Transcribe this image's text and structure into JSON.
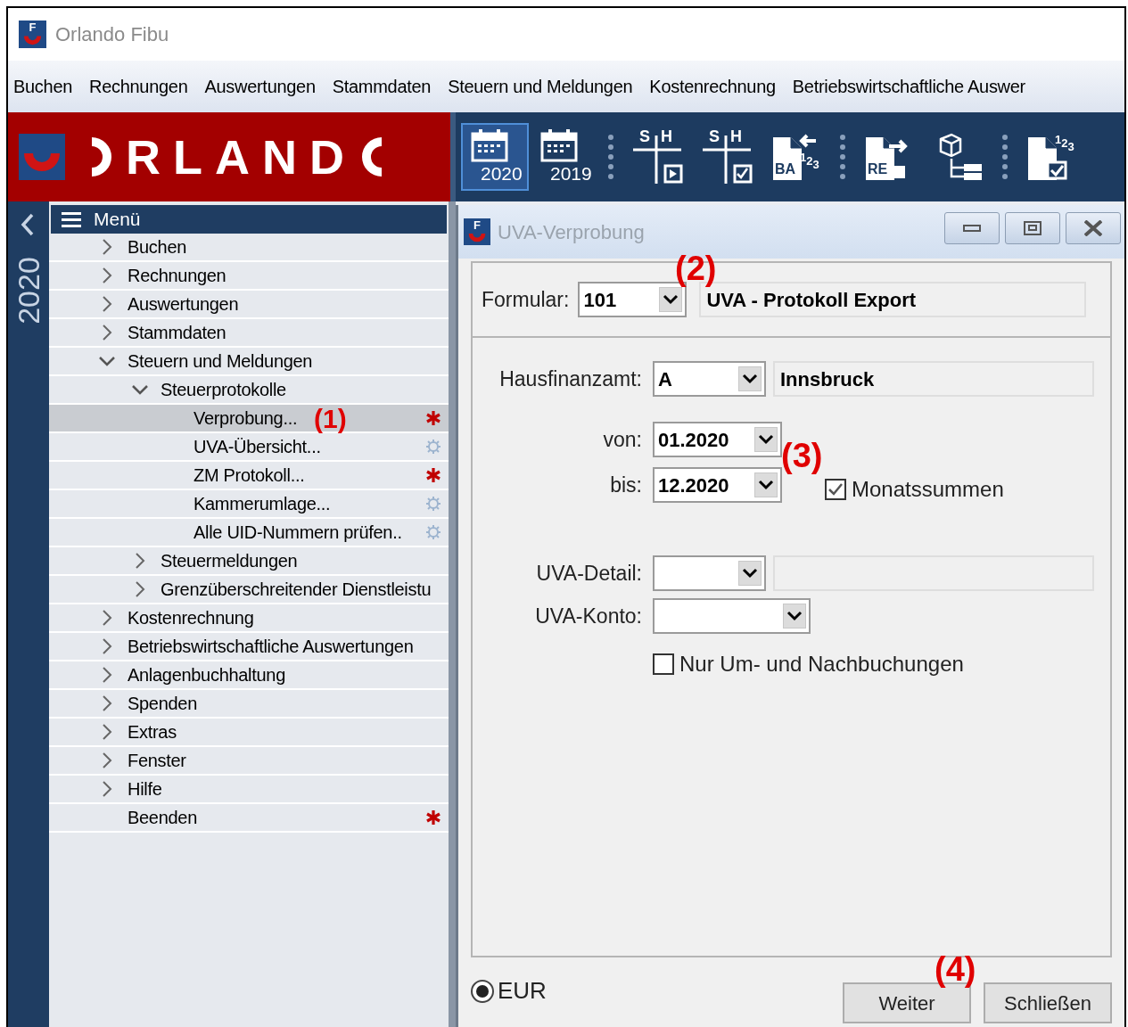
{
  "window": {
    "app_icon_letter": "F",
    "title": "Orlando Fibu"
  },
  "menu_bar": [
    {
      "label": "Buchen"
    },
    {
      "label": "Rechnungen"
    },
    {
      "label": "Auswertungen"
    },
    {
      "label": "Stammdaten"
    },
    {
      "label": "Steuern und Meldungen"
    },
    {
      "label": "Kostenrechnung"
    },
    {
      "label": "Betriebswirtschaftliche Auswer"
    }
  ],
  "logo": {
    "text": "RLAND"
  },
  "toolbar": [
    {
      "kind": "calendar",
      "label": "2020",
      "selected": true
    },
    {
      "kind": "calendar",
      "label": "2019",
      "selected": false
    },
    {
      "kind": "separator"
    },
    {
      "kind": "ledger-play",
      "left": "S",
      "right": "H"
    },
    {
      "kind": "ledger-check",
      "left": "S",
      "right": "H"
    },
    {
      "kind": "document-in",
      "label": "BA",
      "digits": "123"
    },
    {
      "kind": "separator"
    },
    {
      "kind": "document-out",
      "label": "RE"
    },
    {
      "kind": "structure"
    },
    {
      "kind": "separator"
    },
    {
      "kind": "document-check",
      "digits": "123"
    }
  ],
  "sidebar": {
    "year": "2020"
  },
  "tree": {
    "title": "Menü",
    "items": [
      {
        "kind": "group",
        "label": "Buchen",
        "expanded": false
      },
      {
        "kind": "group",
        "label": "Rechnungen",
        "expanded": false
      },
      {
        "kind": "group",
        "label": "Auswertungen",
        "expanded": false
      },
      {
        "kind": "group",
        "label": "Stammdaten",
        "expanded": false
      },
      {
        "kind": "group",
        "label": "Steuern und Meldungen",
        "expanded": true,
        "children": [
          {
            "kind": "group",
            "label": "Steuerprotokolle",
            "expanded": true,
            "children": [
              {
                "kind": "action",
                "label": "Verprobung...",
                "selected": true,
                "starred": true,
                "callout": "(1)"
              },
              {
                "kind": "action",
                "label": "UVA-Übersicht...",
                "selected": false,
                "starred": false
              },
              {
                "kind": "action",
                "label": "ZM Protokoll...",
                "selected": false,
                "starred": true
              },
              {
                "kind": "action",
                "label": "Kammerumlage...",
                "selected": false,
                "starred": false
              },
              {
                "kind": "action",
                "label": "Alle UID-Nummern prüfen..",
                "selected": false,
                "starred": false
              }
            ]
          },
          {
            "kind": "group",
            "label": "Steuermeldungen",
            "expanded": false
          },
          {
            "kind": "group",
            "label": "Grenzüberschreitender Dienstleistu",
            "expanded": false
          }
        ]
      },
      {
        "kind": "group",
        "label": "Kostenrechnung",
        "expanded": false
      },
      {
        "kind": "group",
        "label": "Betriebswirtschaftliche Auswertungen",
        "expanded": false
      },
      {
        "kind": "group",
        "label": "Anlagenbuchhaltung",
        "expanded": false
      },
      {
        "kind": "group",
        "label": "Spenden",
        "expanded": false
      },
      {
        "kind": "group",
        "label": "Extras",
        "expanded": false
      },
      {
        "kind": "group",
        "label": "Fenster",
        "expanded": false
      },
      {
        "kind": "group",
        "label": "Hilfe",
        "expanded": false
      },
      {
        "kind": "action",
        "label": "Beenden",
        "selected": false,
        "starred": true
      }
    ]
  },
  "dialog": {
    "icon_letter": "F",
    "title": "UVA-Verprobung",
    "formular": {
      "label": "Formular:",
      "value": "101",
      "description": "UVA - Protokoll Export",
      "callout": "(2)"
    },
    "hausfinanzamt": {
      "label": "Hausfinanzamt:",
      "value": "A",
      "description": "Innsbruck"
    },
    "von": {
      "label": "von:",
      "value": "01.2020"
    },
    "bis": {
      "label": "bis:",
      "value": "12.2020"
    },
    "period_callout": "(3)",
    "monatssummen": {
      "label": "Monatssummen",
      "checked": true
    },
    "uva_detail": {
      "label": "UVA-Detail:"
    },
    "uva_konto": {
      "label": "UVA-Konto:"
    },
    "nur_um_nachbuchungen": {
      "label": "Nur Um- und Nachbuchungen",
      "checked": false
    },
    "currency": {
      "label": "EUR",
      "selected": true
    },
    "buttons": [
      {
        "label": "Weiter",
        "callout": "(4)"
      },
      {
        "label": "Schließen"
      }
    ]
  }
}
